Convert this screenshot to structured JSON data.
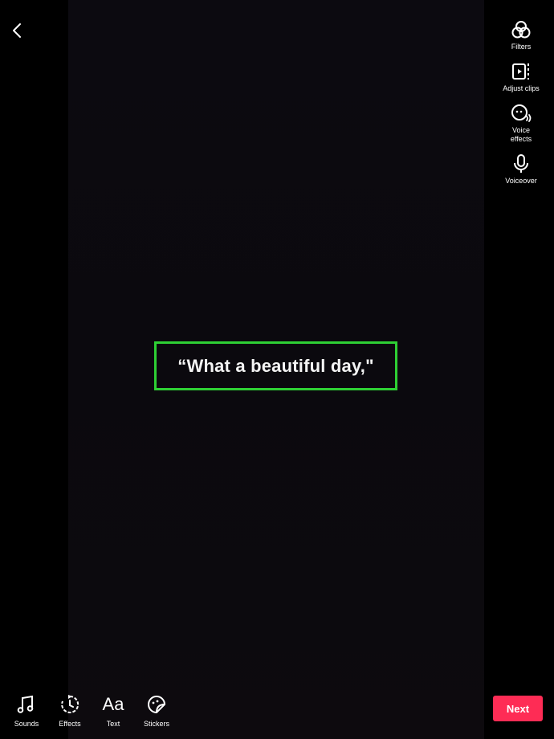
{
  "nav": {
    "back_icon": "chevron-left-icon"
  },
  "sidebar": {
    "items": [
      {
        "label": "Filters",
        "icon": "filters-icon"
      },
      {
        "label": "Adjust clips",
        "icon": "adjust-clips-icon"
      },
      {
        "label": "Voice\neffects",
        "label_line1": "Voice",
        "label_line2": "effects",
        "icon": "voice-effects-icon"
      },
      {
        "label": "Voiceover",
        "icon": "microphone-icon"
      }
    ]
  },
  "caption": {
    "text": "“What a beautiful day,\"",
    "highlight_color": "#2ed034"
  },
  "toolbar": {
    "items": [
      {
        "label": "Sounds",
        "icon": "music-note-icon"
      },
      {
        "label": "Effects",
        "icon": "effects-timer-icon"
      },
      {
        "label": "Text",
        "icon": "text-icon",
        "glyph": "Aa"
      },
      {
        "label": "Stickers",
        "icon": "sticker-icon"
      }
    ],
    "next_label": "Next",
    "next_color": "#fe2c55"
  }
}
